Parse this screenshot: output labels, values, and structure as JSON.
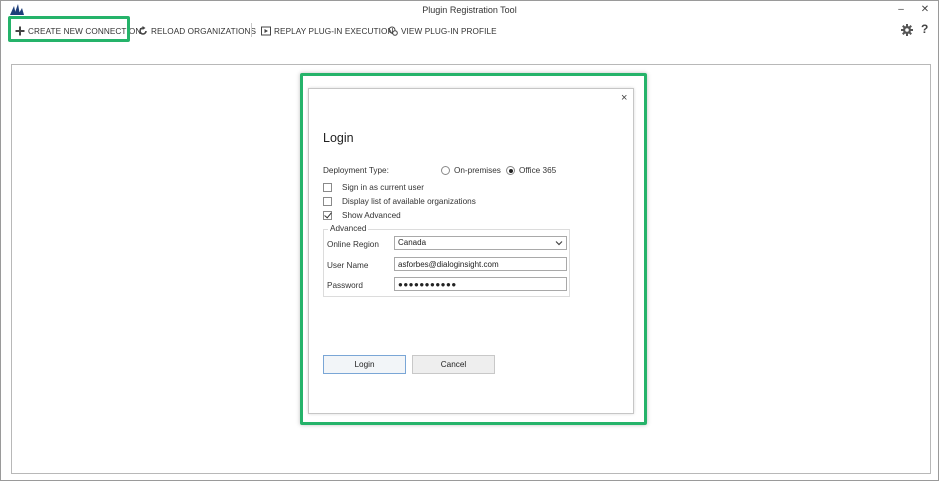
{
  "window": {
    "title": "Plugin Registration Tool",
    "minimize": "–",
    "close": "✕"
  },
  "toolbar": {
    "create_label": "CREATE NEW CONNECTION",
    "reload_label": "RELOAD ORGANIZATIONS",
    "replay_label": "REPLAY PLUG-IN EXECUTION",
    "profile_label": "VIEW PLUG-IN PROFILE",
    "help_label": "?",
    "icons": [
      "plus-icon",
      "reload-icon",
      "replay-icon",
      "profile-icon",
      "gear-icon",
      "help-icon"
    ]
  },
  "dialog": {
    "close": "×",
    "title": "Login",
    "deployment_label": "Deployment Type:",
    "deployment_options": [
      {
        "label": "On-premises",
        "selected": false
      },
      {
        "label": "Office 365",
        "selected": true
      }
    ],
    "checkboxes": [
      {
        "label": "Sign in as current user",
        "checked": false
      },
      {
        "label": "Display list of available organizations",
        "checked": false
      },
      {
        "label": "Show Advanced",
        "checked": true
      }
    ],
    "advanced": {
      "legend": "Advanced",
      "region_label": "Online Region",
      "region_value": "Canada",
      "user_label": "User Name",
      "user_value": "asforbes@dialoginsight.com",
      "password_label": "Password",
      "password_value": "●●●●●●●●●●●"
    },
    "login_button": "Login",
    "cancel_button": "Cancel"
  },
  "colors": {
    "highlight": "#25b36a",
    "login_border": "#7aa6d6"
  }
}
